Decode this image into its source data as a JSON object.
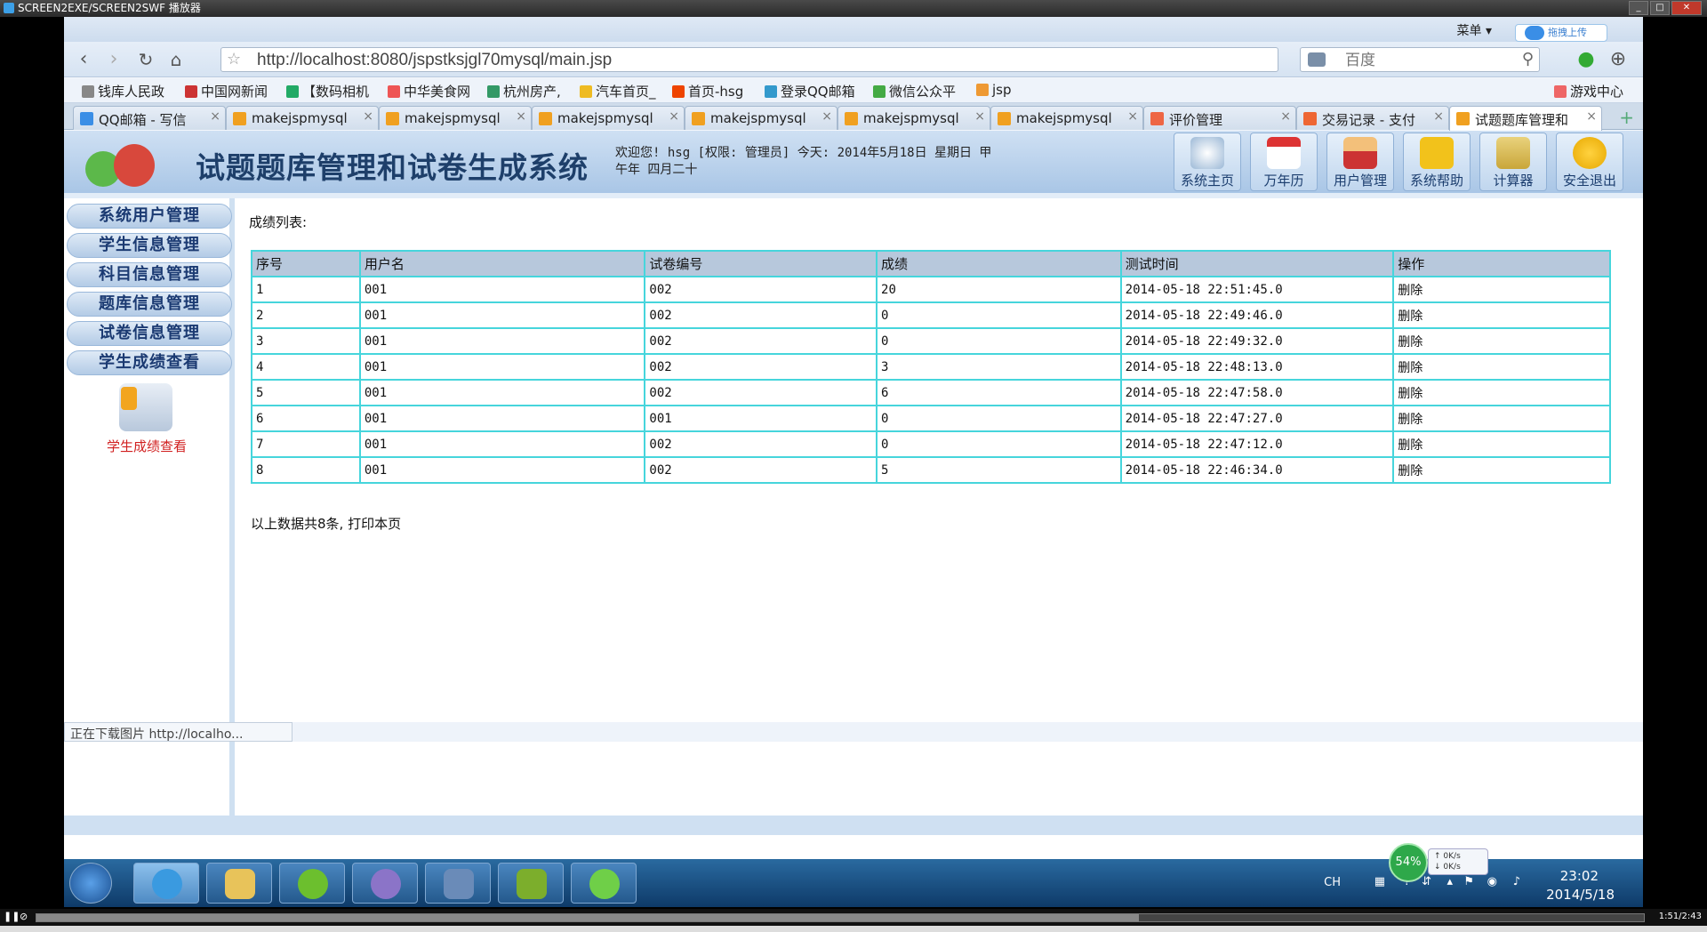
{
  "player": {
    "title": "SCREEN2EXE/SCREEN2SWF 播放器",
    "time": "1:51/2:43",
    "progress": 0.686
  },
  "browser": {
    "menu_label": "菜单 ▾",
    "upload_label": "拖拽上传",
    "url": "http://localhost:8080/jspstksjgl70mysql/main.jsp",
    "search_placeholder": "百度",
    "bookmarks": [
      "钱库人民政",
      "中国网新闻",
      "【数码相机",
      "中华美食网",
      "杭州房产,",
      "汽车首页_",
      "首页-hsg",
      "登录QQ邮箱",
      "微信公众平",
      "jsp",
      "游戏中心"
    ],
    "tabs": [
      {
        "label": "QQ邮箱 - 写信",
        "active": false
      },
      {
        "label": "makejspmysql",
        "active": false
      },
      {
        "label": "makejspmysql",
        "active": false
      },
      {
        "label": "makejspmysql",
        "active": false
      },
      {
        "label": "makejspmysql",
        "active": false
      },
      {
        "label": "makejspmysql",
        "active": false
      },
      {
        "label": "makejspmysql",
        "active": false
      },
      {
        "label": "评价管理",
        "active": false
      },
      {
        "label": "交易记录 - 支付",
        "active": false
      },
      {
        "label": "试题题库管理和",
        "active": true
      }
    ],
    "status_text": "正在下载图片 http://localho..."
  },
  "header": {
    "site_title": "试题题库管理和试卷生成系统",
    "welcome": "欢迎您! hsg [权限: 管理员] 今天: 2014年5月18日 星期日 甲午年 四月二十",
    "buttons": [
      {
        "label": "系统主页",
        "icon": "clock-icon"
      },
      {
        "label": "万年历",
        "icon": "calendar-icon"
      },
      {
        "label": "用户管理",
        "icon": "user-icon"
      },
      {
        "label": "系统帮助",
        "icon": "help-note-icon"
      },
      {
        "label": "计算器",
        "icon": "calculator-icon"
      },
      {
        "label": "安全退出",
        "icon": "power-icon"
      }
    ]
  },
  "sidebar": {
    "items": [
      "系统用户管理",
      "学生信息管理",
      "科目信息管理",
      "题库信息管理",
      "试卷信息管理",
      "学生成绩查看"
    ],
    "current_label": "学生成绩查看"
  },
  "main": {
    "list_title": "成绩列表:",
    "columns": [
      "序号",
      "用户名",
      "试卷编号",
      "成绩",
      "测试时间",
      "操作"
    ],
    "rows": [
      [
        "1",
        "001",
        "002",
        "20",
        "2014-05-18 22:51:45.0",
        "删除"
      ],
      [
        "2",
        "001",
        "002",
        "0",
        "2014-05-18 22:49:46.0",
        "删除"
      ],
      [
        "3",
        "001",
        "002",
        "0",
        "2014-05-18 22:49:32.0",
        "删除"
      ],
      [
        "4",
        "001",
        "002",
        "3",
        "2014-05-18 22:48:13.0",
        "删除"
      ],
      [
        "5",
        "001",
        "002",
        "6",
        "2014-05-18 22:47:58.0",
        "删除"
      ],
      [
        "6",
        "001",
        "001",
        "0",
        "2014-05-18 22:47:27.0",
        "删除"
      ],
      [
        "7",
        "001",
        "002",
        "0",
        "2014-05-18 22:47:12.0",
        "删除"
      ],
      [
        "8",
        "001",
        "002",
        "5",
        "2014-05-18 22:46:34.0",
        "删除"
      ]
    ],
    "footer_text": "以上数据共8条, 打印本页"
  },
  "taskbar": {
    "lang": "CH",
    "time": "23:02",
    "date": "2014/5/18",
    "net_percent": "54%",
    "upload_speed": "0K/s",
    "download_speed": "0K/s"
  }
}
